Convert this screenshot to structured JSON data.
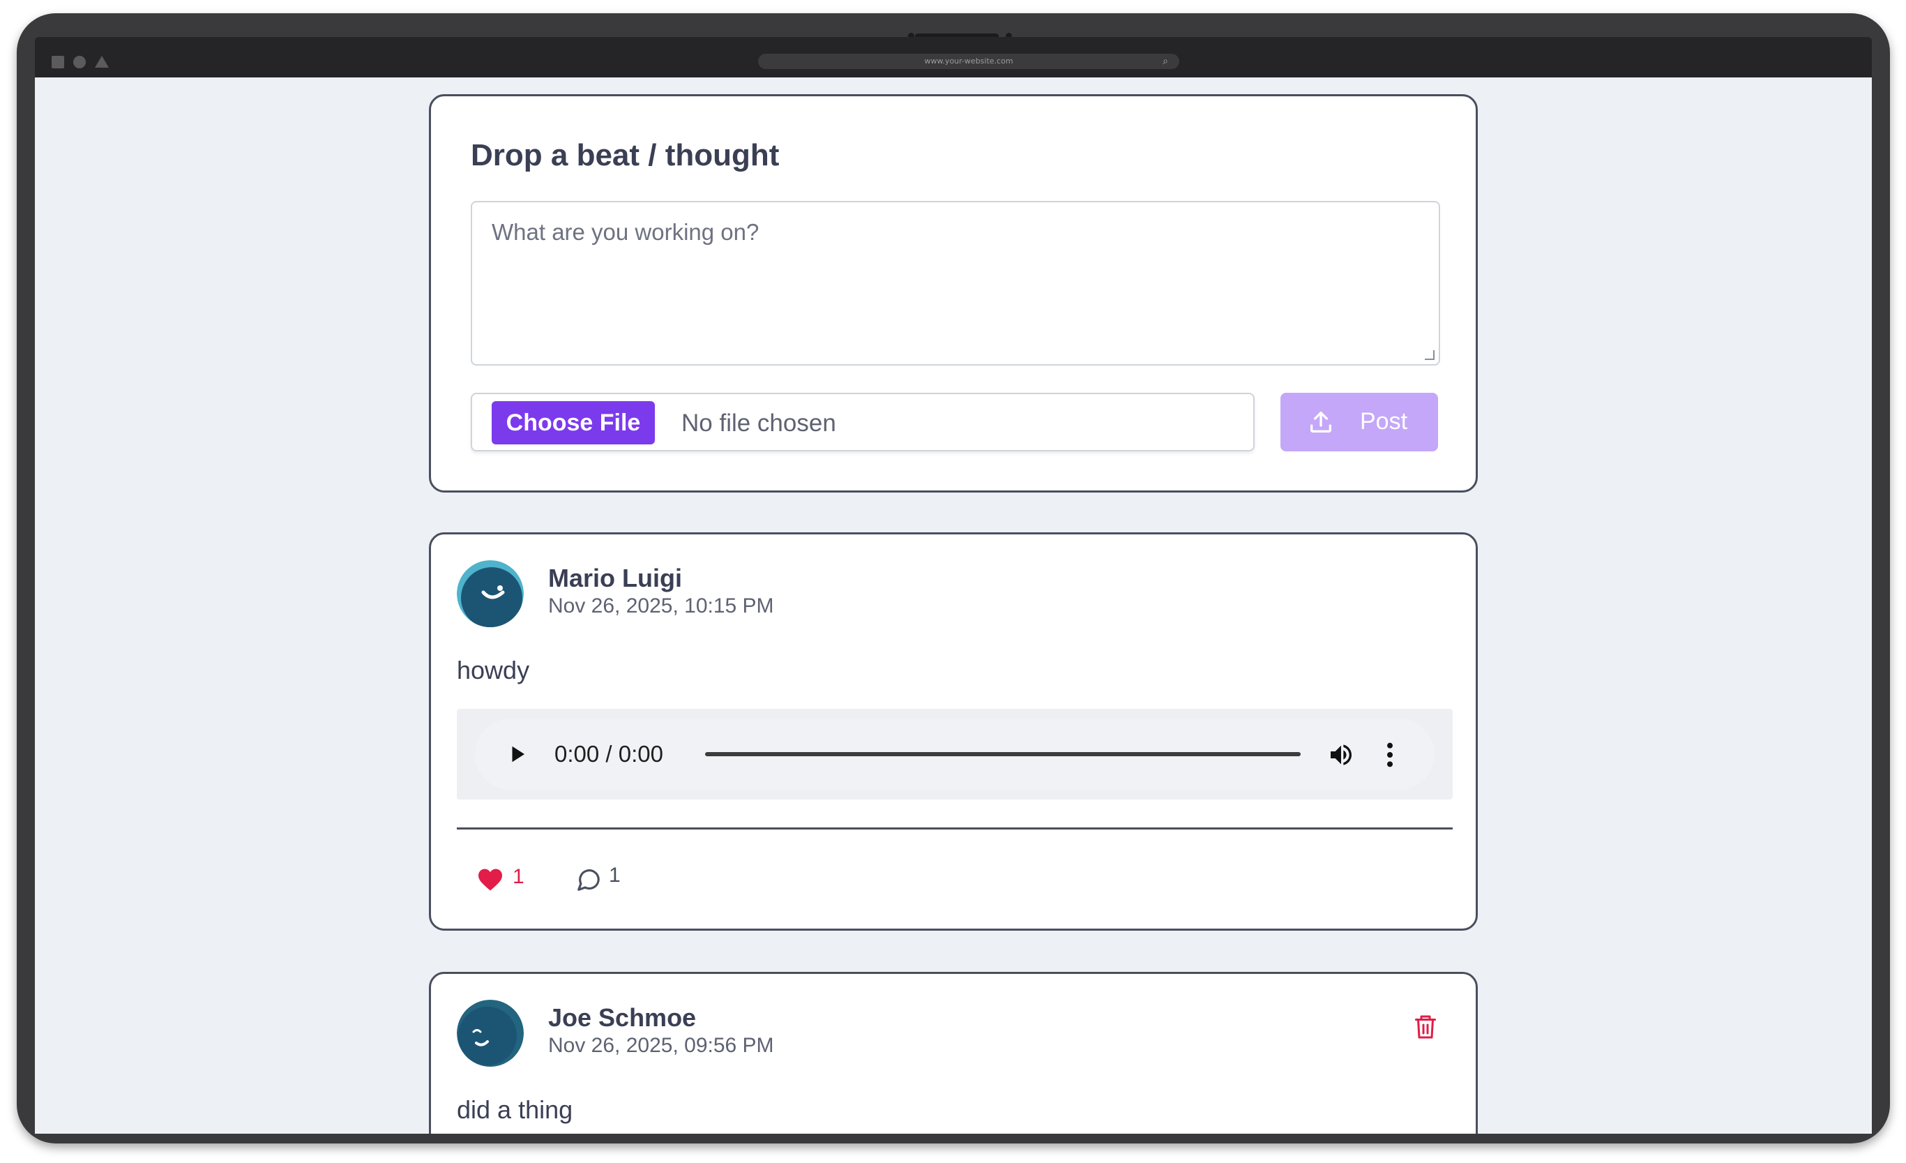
{
  "browser": {
    "url": "www.your-website.com"
  },
  "composer": {
    "title": "Drop a beat / thought",
    "textarea_placeholder": "What are you working on?",
    "choose_file_label": "Choose File",
    "file_status": "No file chosen",
    "post_label": "Post",
    "colors": {
      "choose_button": "#7c3aed",
      "post_button": "#c4a7f8"
    }
  },
  "posts": [
    {
      "author": "Mario Luigi",
      "timestamp": "Nov 26, 2025, 10:15 PM",
      "body": "howdy",
      "audio": {
        "time": "0:00 / 0:00"
      },
      "likes": "1",
      "comments": "1",
      "avatar_icon": "smiley-avatar-icon"
    },
    {
      "author": "Joe Schmoe",
      "timestamp": "Nov 26, 2025, 09:56 PM",
      "body": "did a thing",
      "avatar_icon": "winking-avatar-icon",
      "action_icon": "trash-icon"
    }
  ],
  "colors": {
    "background": "#edf0f5",
    "card_border": "#4a4f5e",
    "like": "#e11d48",
    "delete": "#e11d48"
  }
}
